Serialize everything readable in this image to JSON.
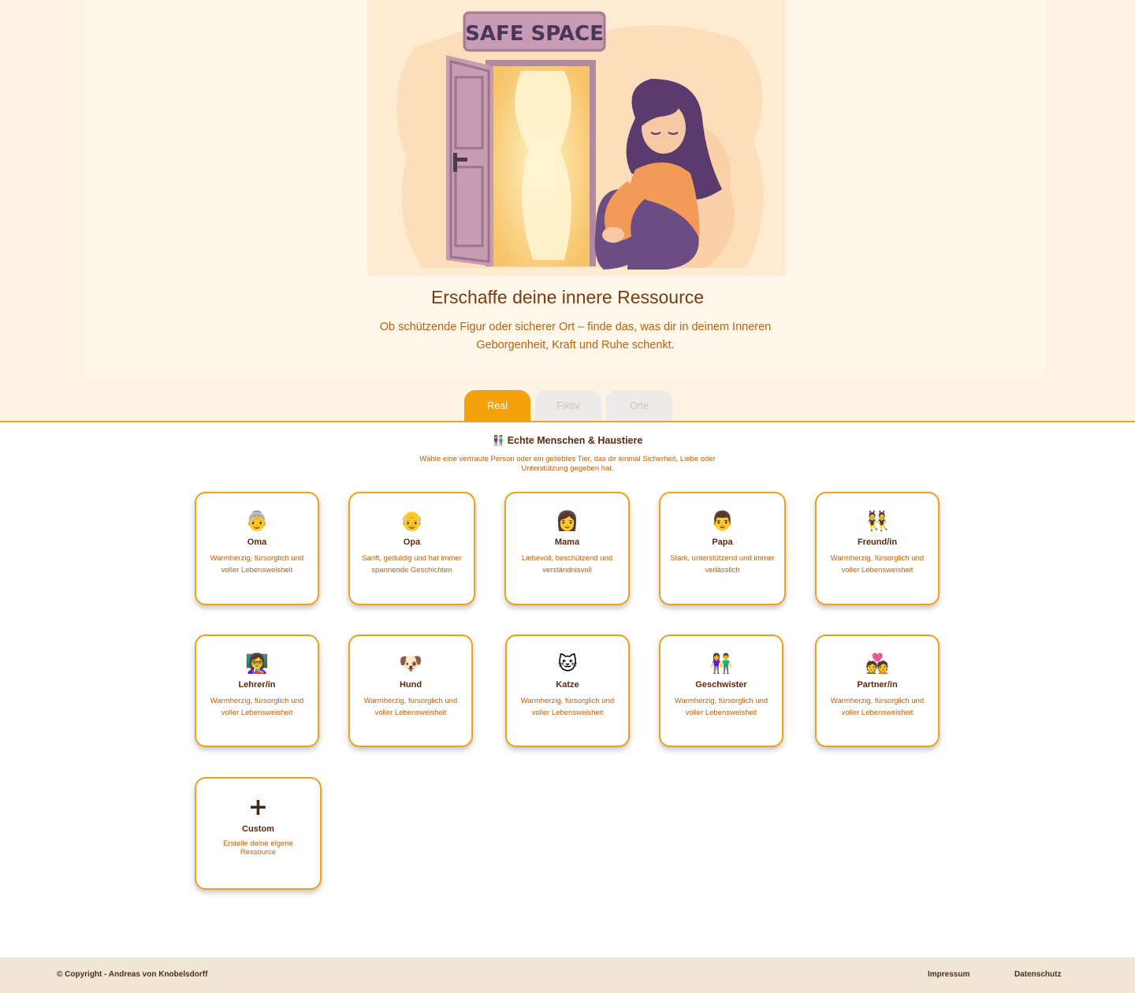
{
  "hero": {
    "sign_text": "SAFE SPACE",
    "title": "Erschaffe deine innere Ressource",
    "subtitle": "Ob schützende Figur oder sicherer Ort – finde das, was dir in deinem Inneren Geborgenheit, Kraft und Ruhe schenkt."
  },
  "tabs": [
    {
      "label": "Real",
      "active": true
    },
    {
      "label": "Fiktiv",
      "active": false
    },
    {
      "label": "Orte",
      "active": false
    }
  ],
  "section": {
    "title": "👫 Echte Menschen & Haustiere",
    "description": "Wähle eine vertraute Person oder ein geliebtes Tier, das dir einmal Sicherheit, Liebe oder Unterstützung gegeben hat."
  },
  "cards": [
    {
      "emoji": "👵",
      "name": "Oma",
      "desc": "Warmherzig, fürsorglich und voller Lebensweisheit"
    },
    {
      "emoji": "👴",
      "name": "Opa",
      "desc": "Sanft, geduldig und hat immer spannende Geschichten"
    },
    {
      "emoji": "👩",
      "name": "Mama",
      "desc": "Liebevoll, beschützend und verständnisvoll"
    },
    {
      "emoji": "👨",
      "name": "Papa",
      "desc": "Stark, unterstützend und immer verlässlich"
    },
    {
      "emoji": "👯",
      "name": "Freund/in",
      "desc": "Warmherzig, fürsorglich und voller Lebensweisheit"
    },
    {
      "emoji": "👩‍🏫",
      "name": "Lehrer/in",
      "desc": "Warmherzig, fürsorglich und voller Lebensweisheit"
    },
    {
      "emoji": "🐶",
      "name": "Hund",
      "desc": "Warmherzig, fürsorglich und voller Lebensweisheit"
    },
    {
      "emoji": "🐱",
      "name": "Katze",
      "desc": "Warmherzig, fürsorglich und voller Lebensweisheit"
    },
    {
      "emoji": "👫",
      "name": "Geschwister",
      "desc": "Warmherzig, fürsorglich und voller Lebensweisheit"
    },
    {
      "emoji": "💑",
      "name": "Partner/in",
      "desc": "Warmherzig, fürsorglich und voller Lebensweisheit"
    }
  ],
  "custom_card": {
    "icon": "+",
    "name": "Custom",
    "desc": "Erstelle deine eigene Ressource"
  },
  "footer": {
    "copyright": "© Copyright - Andreas von Knobelsdorff",
    "impressum": "Impressum",
    "datenschutz": "Datenschutz"
  },
  "colors": {
    "accent": "#f4a10b",
    "heading": "#7a3a12",
    "text_orange": "#c0610d",
    "hero_bg": "#fff4e3",
    "footer_bg": "#f1e5d6"
  }
}
